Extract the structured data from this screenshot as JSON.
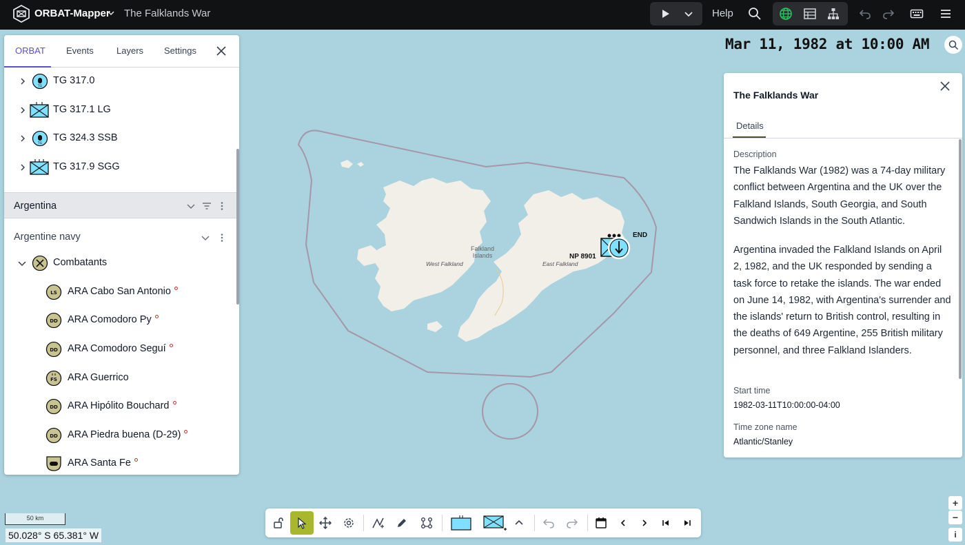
{
  "app": {
    "name": "ORBAT-Mapper",
    "scenario_title": "The Falklands War"
  },
  "topbar": {
    "help_label": "Help"
  },
  "left_panel": {
    "tabs": [
      {
        "label": "ORBAT",
        "active": true
      },
      {
        "label": "Events",
        "active": false
      },
      {
        "label": "Layers",
        "active": false
      },
      {
        "label": "Settings",
        "active": false
      }
    ],
    "uk_units": [
      {
        "label": "TG 317.0",
        "symbol": "submarine"
      },
      {
        "label": "TG 317.1 LG",
        "symbol": "infantry"
      },
      {
        "label": "TG 324.3 SSB",
        "symbol": "submarine"
      },
      {
        "label": "TG 317.9 SGG",
        "symbol": "infantry-hq"
      }
    ],
    "side": {
      "name": "Argentina"
    },
    "group": {
      "name": "Argentine navy"
    },
    "subgroup": {
      "name": "Combatants"
    },
    "argentine_units": [
      {
        "label": "ARA Cabo San Antonio",
        "symbol_text": "LS",
        "has_marker": true
      },
      {
        "label": "ARA Comodoro Py",
        "symbol_text": "DD",
        "has_marker": true
      },
      {
        "label": "ARA Comodoro Seguí",
        "symbol_text": "DD",
        "has_marker": true
      },
      {
        "label": "ARA Guerrico",
        "symbol_text": "FS",
        "has_marker": false
      },
      {
        "label": "ARA Hipólito Bouchard",
        "symbol_text": "DD",
        "has_marker": true
      },
      {
        "label": "ARA Piedra buena (D-29)",
        "symbol_text": "DD",
        "has_marker": true
      },
      {
        "label": "ARA Santa Fe",
        "symbol_text": "",
        "has_marker": true
      }
    ]
  },
  "map": {
    "datetime": "Mar 11, 1982 at 10:00 AM",
    "island_name_line1": "Falkland",
    "island_name_line2": "Islands",
    "west_label": "West Falkland",
    "east_label": "East Falkland",
    "unit_label": "NP 8901",
    "end_label": "END",
    "scale_label": "50 km",
    "coordinates": "50.028° S 65.381° W",
    "colors": {
      "water": "#aad3df",
      "land": "#f2efe9",
      "accent": "#a9b72c",
      "friendly": "#80e0ff"
    }
  },
  "details_panel": {
    "title": "The Falklands War",
    "tab_label": "Details",
    "description_label": "Description",
    "description_p1": "The Falklands War (1982) was a 74-day military conflict between Argentina and the UK over the Falkland Islands, South Georgia, and South Sandwich Islands in the South Atlantic.",
    "description_p2": "Argentina invaded the Falkland Islands on April 2, 1982, and the UK responded by sending a task force to retake the islands. The war ended on June 14, 1982, with Argentina's surrender and the islands' return to British control, resulting in the deaths of 649 Argentine, 255 British military personnel, and three Falkland Islanders.",
    "start_time_label": "Start time",
    "start_time_value": "1982-03-11T10:00:00-04:00",
    "timezone_label": "Time zone name",
    "timezone_value": "Atlantic/Stanley"
  },
  "zoom": {
    "in": "+",
    "out": "−",
    "info": "i"
  }
}
